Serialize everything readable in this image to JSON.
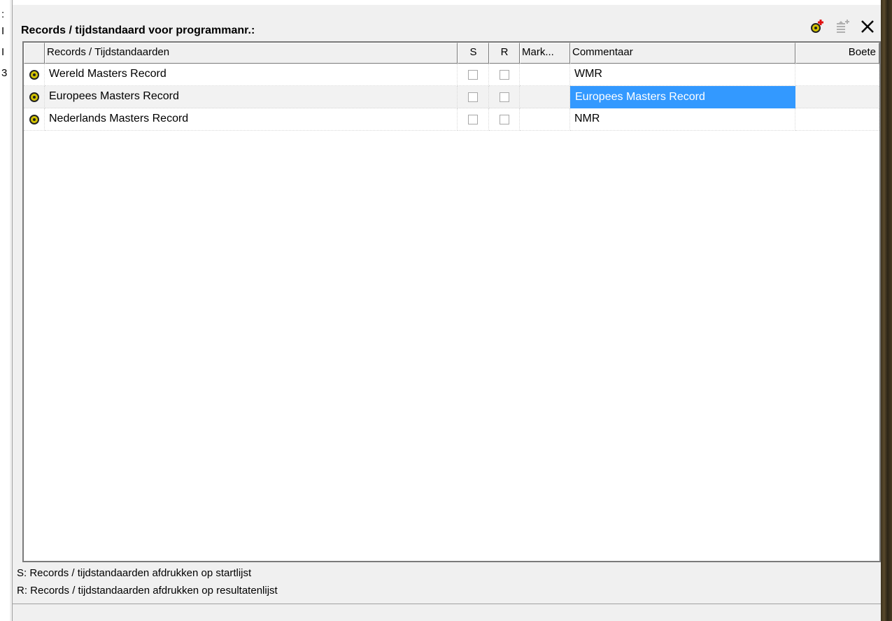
{
  "left_fragments": [
    ":",
    "I",
    "I",
    "3"
  ],
  "panel": {
    "title": "Records / tijdstandaard voor programmanr.:",
    "toolbar": {
      "add_record_icon": "add-record-icon",
      "add_time_standard_icon": "add-time-standard-icon",
      "close_icon": "close-icon"
    }
  },
  "grid": {
    "columns": {
      "indicator": "",
      "name": "Records / Tijdstandaarden",
      "s": "S",
      "r": "R",
      "mark": "Mark...",
      "comment": "Commentaar",
      "penalty": "Boete"
    },
    "rows": [
      {
        "name": "Wereld Masters Record",
        "s": false,
        "r": false,
        "mark": "",
        "comment": "WMR",
        "penalty": ""
      },
      {
        "name": "Europees Masters Record",
        "s": false,
        "r": false,
        "mark": "",
        "comment": "Europees Masters Record",
        "penalty": ""
      },
      {
        "name": "Nederlands Masters Record",
        "s": false,
        "r": false,
        "mark": "",
        "comment": "NMR",
        "penalty": ""
      }
    ],
    "selected_cell": {
      "row": 1,
      "column": "comment"
    }
  },
  "legend": {
    "s_line": "S: Records / tijdstandaarden afdrukken op startlijst",
    "r_line": "R: Records / tijdstandaarden afdrukken op resultatenlijst"
  },
  "colors": {
    "selection": "#3399ff",
    "record_icon": "#d4c400"
  }
}
